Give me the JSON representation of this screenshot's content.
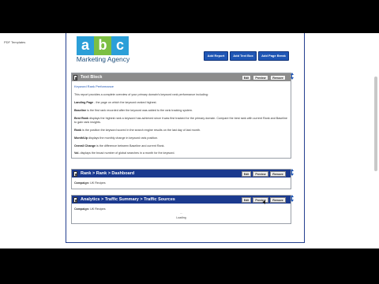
{
  "sidebar": {
    "link": "PDF Templates"
  },
  "logo": {
    "letters": [
      "a",
      "b",
      "c"
    ],
    "letter_colors": [
      "#2b9fd8",
      "#7cbf42",
      "#2b9fd8"
    ],
    "tagline": "Marketing Agency"
  },
  "toolbar": {
    "add_report": "Add Report",
    "add_text_box": "Add Text Box",
    "add_page_break": "Add Page Break"
  },
  "panels": [
    {
      "title": "Text Block",
      "buttons": {
        "edit": "Edit",
        "preview": "Preview",
        "remove": "Remove"
      },
      "subtitle": "Keyword Rank Performance",
      "intro": "This report provides a complete overview of your primary domain's keyword rank performance including:",
      "items": [
        {
          "term": "Landing Page",
          "desc": " - the page on which the keyword ranked highest."
        },
        {
          "term": "Baseline",
          "desc": " is the first rank recorded after the keyword was added to the rank tracking system."
        },
        {
          "term": "Best Rank",
          "desc": " displays the highest rank a keyword has achieved since it was first tracked for the primary domain. Compare the best rank with current Rank and Baseline to gain rank insights."
        },
        {
          "term": "Rank",
          "desc": " is the position the keyword scored in the search engine results on the last day of last month."
        },
        {
          "term": "Month/Up",
          "desc": " displays the monthly change in keyword rank position."
        },
        {
          "term": "Overall Change",
          "desc": " is the difference between Baseline and current Rank."
        },
        {
          "term": "Vol.",
          "desc": " displays the broad number of global searches in a month for the keyword."
        }
      ]
    },
    {
      "title": "Rank > Rank > Dashboard",
      "buttons": {
        "edit": "Edit",
        "preview": "Preview",
        "remove": "Remove"
      },
      "campaign_label": "Campaign:",
      "campaign_value": "UK Recipes"
    },
    {
      "title": "Analytics > Traffic Summary > Traffic Sources",
      "buttons": {
        "edit": "Edit",
        "preview": "Preview",
        "remove": "Remove"
      },
      "campaign_label": "Campaign:",
      "campaign_value": "UK Recipes",
      "loading_dots": "...",
      "loading_text": "Loading"
    }
  ]
}
